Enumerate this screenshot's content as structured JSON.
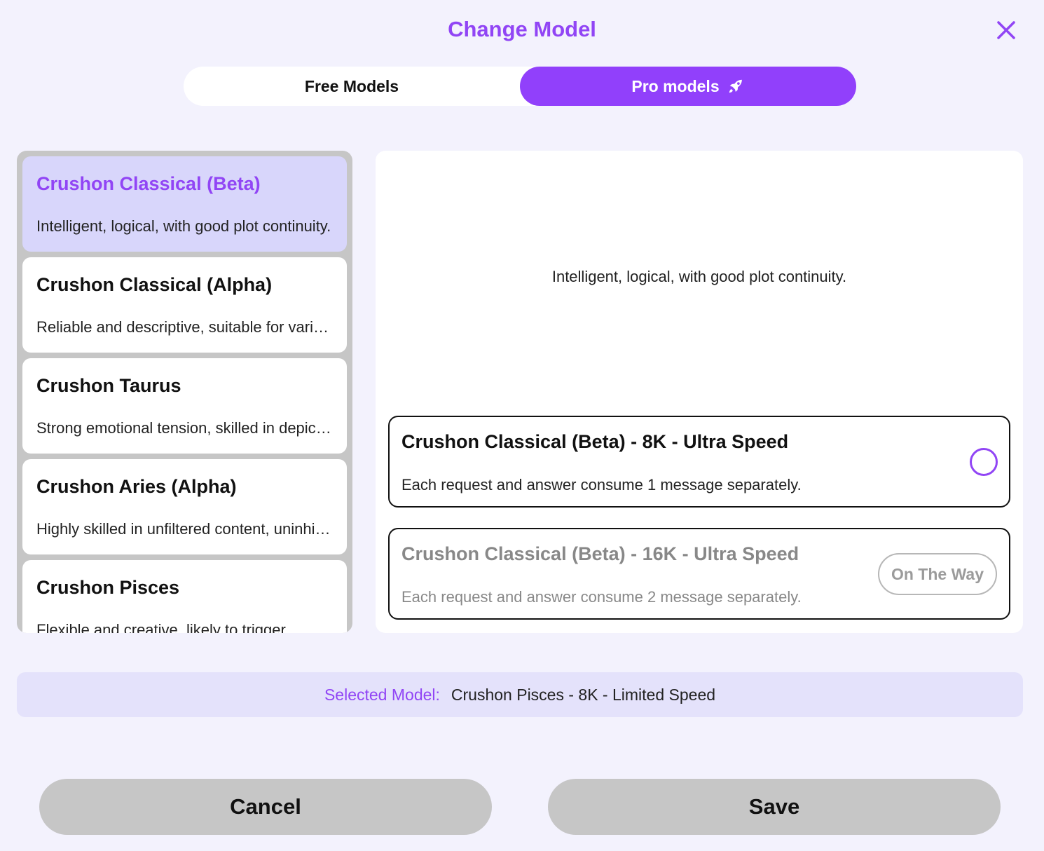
{
  "dialog": {
    "title": "Change Model",
    "close_icon": "close-icon"
  },
  "tabs": [
    {
      "label": "Free Models",
      "active": false
    },
    {
      "label": "Pro models",
      "active": true,
      "icon": "rocket-icon"
    }
  ],
  "colors": {
    "accent": "#9145f5",
    "active_tab": "#9140fb",
    "selected_item_bg": "#d8d6fb",
    "page_bg": "#f3f2fd",
    "button_bg": "#c6c6c6"
  },
  "models": [
    {
      "name": "Crushon Classical (Beta)",
      "desc": "Intelligent, logical, with good plot continuity.",
      "selected": true
    },
    {
      "name": "Crushon Classical (Alpha)",
      "desc": "Reliable and descriptive, suitable for various scenarios.",
      "selected": false
    },
    {
      "name": "Crushon Taurus",
      "desc": "Strong emotional tension, skilled in depicting emotions.",
      "selected": false
    },
    {
      "name": "Crushon Aries (Alpha)",
      "desc": "Highly skilled in unfiltered content, uninhibited.",
      "selected": false
    },
    {
      "name": "Crushon Pisces",
      "desc": "Flexible and creative, likely to trigger",
      "selected": false
    }
  ],
  "detail": {
    "description": "Intelligent, logical, with good plot continuity.",
    "options": [
      {
        "name": "Crushon Classical (Beta) - 8K - Ultra Speed",
        "desc": "Each request and answer consume 1 message separately.",
        "state": "radio-unchecked"
      },
      {
        "name": "Crushon Classical (Beta) - 16K - Ultra Speed",
        "desc": "Each request and answer consume 2 message separately.",
        "badge": "On The Way",
        "state": "disabled"
      }
    ]
  },
  "selected": {
    "label": "Selected Model:",
    "value": "Crushon Pisces - 8K - Limited Speed"
  },
  "buttons": {
    "cancel": "Cancel",
    "save": "Save"
  }
}
